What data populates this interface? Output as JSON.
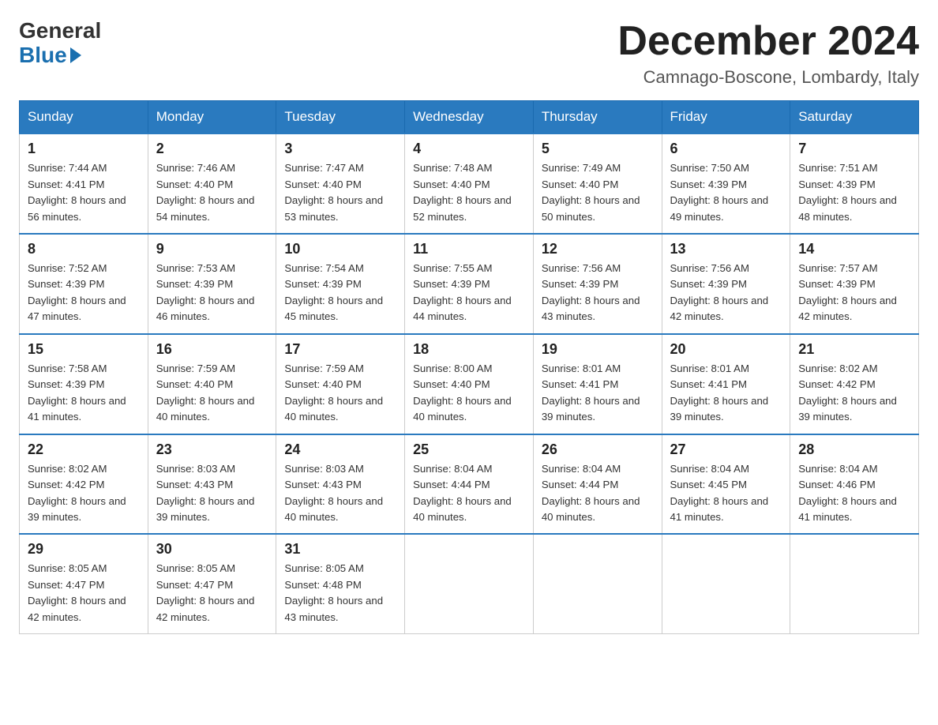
{
  "header": {
    "logo_general": "General",
    "logo_blue": "Blue",
    "month_title": "December 2024",
    "location": "Camnago-Boscone, Lombardy, Italy"
  },
  "days_of_week": [
    "Sunday",
    "Monday",
    "Tuesday",
    "Wednesday",
    "Thursday",
    "Friday",
    "Saturday"
  ],
  "weeks": [
    [
      {
        "day": "1",
        "sunrise": "7:44 AM",
        "sunset": "4:41 PM",
        "daylight": "8 hours and 56 minutes."
      },
      {
        "day": "2",
        "sunrise": "7:46 AM",
        "sunset": "4:40 PM",
        "daylight": "8 hours and 54 minutes."
      },
      {
        "day": "3",
        "sunrise": "7:47 AM",
        "sunset": "4:40 PM",
        "daylight": "8 hours and 53 minutes."
      },
      {
        "day": "4",
        "sunrise": "7:48 AM",
        "sunset": "4:40 PM",
        "daylight": "8 hours and 52 minutes."
      },
      {
        "day": "5",
        "sunrise": "7:49 AM",
        "sunset": "4:40 PM",
        "daylight": "8 hours and 50 minutes."
      },
      {
        "day": "6",
        "sunrise": "7:50 AM",
        "sunset": "4:39 PM",
        "daylight": "8 hours and 49 minutes."
      },
      {
        "day": "7",
        "sunrise": "7:51 AM",
        "sunset": "4:39 PM",
        "daylight": "8 hours and 48 minutes."
      }
    ],
    [
      {
        "day": "8",
        "sunrise": "7:52 AM",
        "sunset": "4:39 PM",
        "daylight": "8 hours and 47 minutes."
      },
      {
        "day": "9",
        "sunrise": "7:53 AM",
        "sunset": "4:39 PM",
        "daylight": "8 hours and 46 minutes."
      },
      {
        "day": "10",
        "sunrise": "7:54 AM",
        "sunset": "4:39 PM",
        "daylight": "8 hours and 45 minutes."
      },
      {
        "day": "11",
        "sunrise": "7:55 AM",
        "sunset": "4:39 PM",
        "daylight": "8 hours and 44 minutes."
      },
      {
        "day": "12",
        "sunrise": "7:56 AM",
        "sunset": "4:39 PM",
        "daylight": "8 hours and 43 minutes."
      },
      {
        "day": "13",
        "sunrise": "7:56 AM",
        "sunset": "4:39 PM",
        "daylight": "8 hours and 42 minutes."
      },
      {
        "day": "14",
        "sunrise": "7:57 AM",
        "sunset": "4:39 PM",
        "daylight": "8 hours and 42 minutes."
      }
    ],
    [
      {
        "day": "15",
        "sunrise": "7:58 AM",
        "sunset": "4:39 PM",
        "daylight": "8 hours and 41 minutes."
      },
      {
        "day": "16",
        "sunrise": "7:59 AM",
        "sunset": "4:40 PM",
        "daylight": "8 hours and 40 minutes."
      },
      {
        "day": "17",
        "sunrise": "7:59 AM",
        "sunset": "4:40 PM",
        "daylight": "8 hours and 40 minutes."
      },
      {
        "day": "18",
        "sunrise": "8:00 AM",
        "sunset": "4:40 PM",
        "daylight": "8 hours and 40 minutes."
      },
      {
        "day": "19",
        "sunrise": "8:01 AM",
        "sunset": "4:41 PM",
        "daylight": "8 hours and 39 minutes."
      },
      {
        "day": "20",
        "sunrise": "8:01 AM",
        "sunset": "4:41 PM",
        "daylight": "8 hours and 39 minutes."
      },
      {
        "day": "21",
        "sunrise": "8:02 AM",
        "sunset": "4:42 PM",
        "daylight": "8 hours and 39 minutes."
      }
    ],
    [
      {
        "day": "22",
        "sunrise": "8:02 AM",
        "sunset": "4:42 PM",
        "daylight": "8 hours and 39 minutes."
      },
      {
        "day": "23",
        "sunrise": "8:03 AM",
        "sunset": "4:43 PM",
        "daylight": "8 hours and 39 minutes."
      },
      {
        "day": "24",
        "sunrise": "8:03 AM",
        "sunset": "4:43 PM",
        "daylight": "8 hours and 40 minutes."
      },
      {
        "day": "25",
        "sunrise": "8:04 AM",
        "sunset": "4:44 PM",
        "daylight": "8 hours and 40 minutes."
      },
      {
        "day": "26",
        "sunrise": "8:04 AM",
        "sunset": "4:44 PM",
        "daylight": "8 hours and 40 minutes."
      },
      {
        "day": "27",
        "sunrise": "8:04 AM",
        "sunset": "4:45 PM",
        "daylight": "8 hours and 41 minutes."
      },
      {
        "day": "28",
        "sunrise": "8:04 AM",
        "sunset": "4:46 PM",
        "daylight": "8 hours and 41 minutes."
      }
    ],
    [
      {
        "day": "29",
        "sunrise": "8:05 AM",
        "sunset": "4:47 PM",
        "daylight": "8 hours and 42 minutes."
      },
      {
        "day": "30",
        "sunrise": "8:05 AM",
        "sunset": "4:47 PM",
        "daylight": "8 hours and 42 minutes."
      },
      {
        "day": "31",
        "sunrise": "8:05 AM",
        "sunset": "4:48 PM",
        "daylight": "8 hours and 43 minutes."
      },
      null,
      null,
      null,
      null
    ]
  ]
}
